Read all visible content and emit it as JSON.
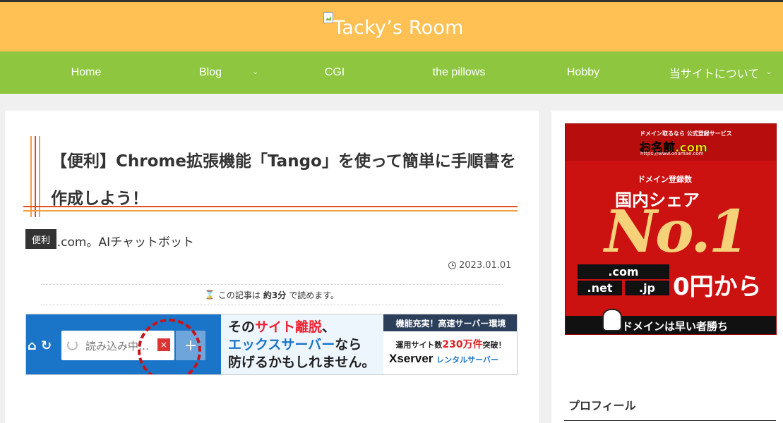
{
  "header": {
    "site_name": "Tacky’s Room",
    "bg_color": "#ffc153"
  },
  "nav": {
    "bg_color": "#8ec73f",
    "items": [
      {
        "label": "Home",
        "has_submenu": false
      },
      {
        "label": "Blog",
        "has_submenu": true
      },
      {
        "label": "CGI",
        "has_submenu": false
      },
      {
        "label": "the pillows",
        "has_submenu": false
      },
      {
        "label": "Hobby",
        "has_submenu": false
      },
      {
        "label": "当サイトについて",
        "has_submenu": true
      }
    ],
    "caret_glyph": "⌄"
  },
  "post": {
    "title": "【便利】Chrome拡張機能「Tango」を使って簡単に手順書を作成しよう！",
    "category": "便利",
    "excerpt": "u.com。AIチャットボット",
    "date": "2023.01.01",
    "readtime_prefix": "この記事は",
    "readtime_value": "約3分",
    "readtime_suffix": "で読めます。",
    "hourglass_glyph": "⌛"
  },
  "banner": {
    "tab_text": "読み込み中…",
    "close_glyph": "×",
    "plus_glyph": "+",
    "nav_icons": "⌂ ↻",
    "copy_line1_a": "その",
    "copy_line1_b": "サイト離脱",
    "copy_line1_c": "、",
    "copy_line2_a": "エックスサーバー",
    "copy_line2_b": "なら",
    "copy_line3": "防げるかもしれません。",
    "head": "機能充実！高速サーバー環境",
    "line_a": "運用サイト数",
    "line_b": "230万件",
    "line_c": "突破！",
    "brand": "Xserver",
    "brand_sub": "レンタルサーバー"
  },
  "ad": {
    "top_small": "ドメイン取るなら 公式登録サービス",
    "logo": "お名前.com",
    "url": "https://www.onamae.com",
    "share_small": "ドメイン登録数",
    "share": "国内シェア",
    "no1": "No.1",
    "tld_com": ".com",
    "tld_net": ".net",
    "tld_jp": ".jp",
    "price": "0円から",
    "bottom": "ドメインは早い者勝ち"
  },
  "sidebar": {
    "heading": "プロフィール"
  },
  "colors": {
    "title_line_orange": "#f0a040",
    "title_line_red": "#e05020",
    "content_bg": "#ffffff",
    "page_bg": "#f0f0f0"
  }
}
